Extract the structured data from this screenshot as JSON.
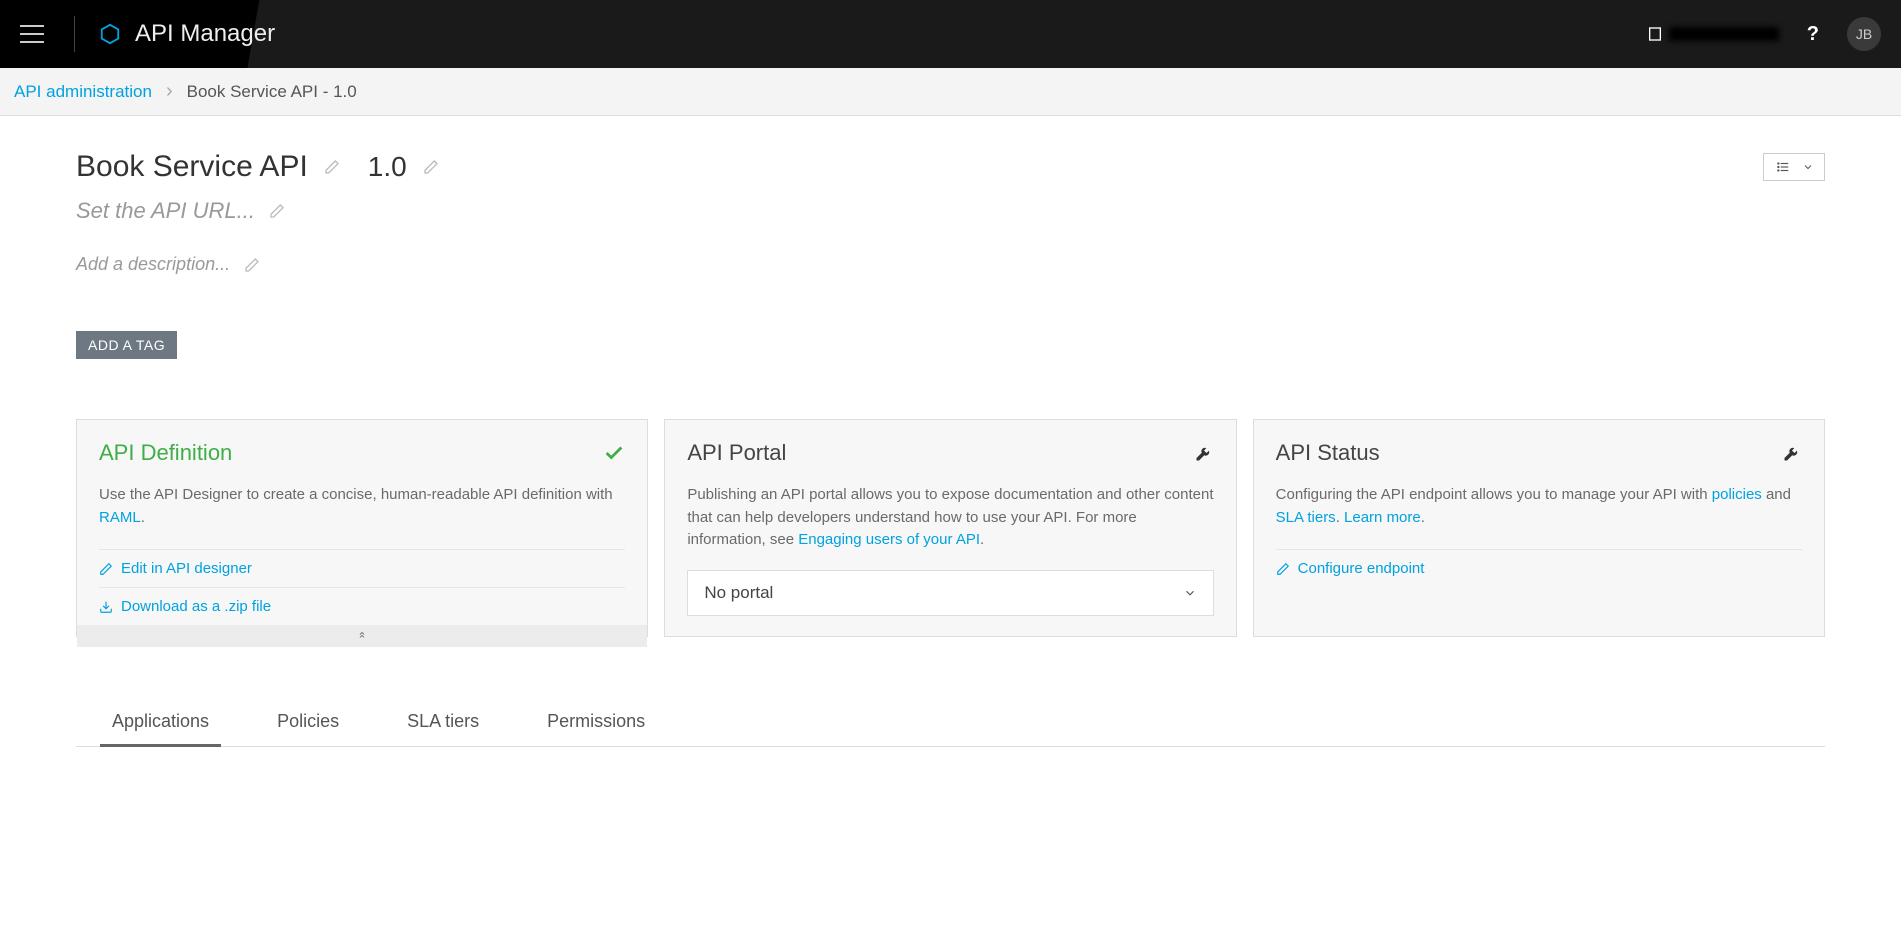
{
  "header": {
    "app_title": "API Manager",
    "help_label": "?",
    "avatar_initials": "JB"
  },
  "breadcrumb": {
    "root": "API administration",
    "current": "Book Service API - 1.0"
  },
  "page": {
    "api_name": "Book Service API",
    "api_version": "1.0",
    "url_placeholder": "Set the API URL...",
    "desc_placeholder": "Add a description...",
    "add_tag_label": "ADD A TAG"
  },
  "cards": {
    "definition": {
      "title": "API Definition",
      "body_prefix": "Use the API Designer to create a concise, human-readable API definition with ",
      "body_link": "RAML",
      "body_suffix": ".",
      "action_edit": "Edit in API designer",
      "action_download": "Download as a .zip file"
    },
    "portal": {
      "title": "API Portal",
      "body_prefix": "Publishing an API portal allows you to expose documentation and other content that can help developers understand how to use your API. For more information, see ",
      "body_link": "Engaging users of your API",
      "body_suffix": ".",
      "select_value": "No portal"
    },
    "status": {
      "title": "API Status",
      "body_prefix": "Configuring the API endpoint allows you to manage your API with ",
      "body_link1": "policies",
      "body_mid": " and ",
      "body_link2": "SLA tiers",
      "body_suffix1": ". ",
      "body_link3": "Learn more",
      "body_suffix2": ".",
      "action_configure": "Configure endpoint"
    }
  },
  "tabs": {
    "items": [
      "Applications",
      "Policies",
      "SLA tiers",
      "Permissions"
    ],
    "active_index": 0
  }
}
